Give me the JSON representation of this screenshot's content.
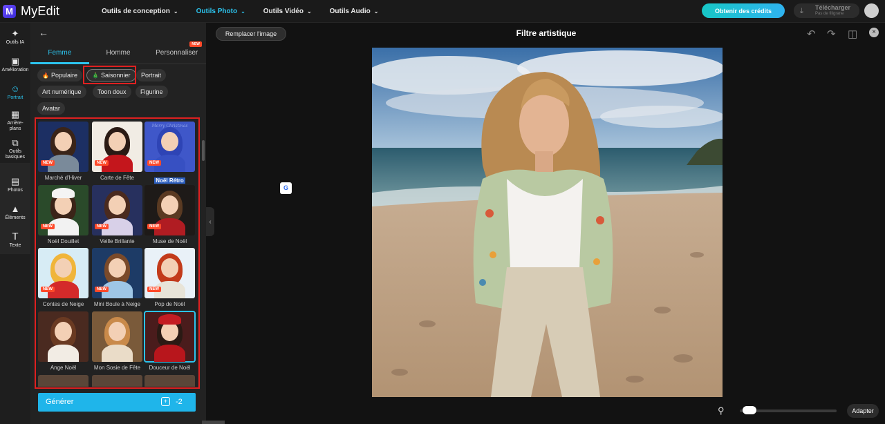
{
  "app": {
    "name": "MyEdit",
    "logo_letter": "M"
  },
  "nav": [
    {
      "label": "Outils de conception",
      "active": false
    },
    {
      "label": "Outils Photo",
      "active": true
    },
    {
      "label": "Outils Vidéo",
      "active": false
    },
    {
      "label": "Outils Audio",
      "active": false
    }
  ],
  "header": {
    "credits_label": "Obtenir des crédits",
    "download_label": "Télécharger",
    "download_sublabel": "Pas de filigrane"
  },
  "rail": [
    {
      "label": "Outils IA",
      "icon": "magic-wand-icon",
      "active": false
    },
    {
      "label": "Amélioration",
      "icon": "image-enhance-icon",
      "active": false
    },
    {
      "label": "Portrait",
      "icon": "portrait-icon",
      "active": true
    },
    {
      "label": "Arrière-plans",
      "icon": "background-icon",
      "active": false
    },
    {
      "label": "Outils basiques",
      "icon": "crop-icon",
      "active": false
    },
    {
      "label": "Photos",
      "icon": "photo-icon",
      "active": false
    },
    {
      "label": "Éléments",
      "icon": "elements-icon",
      "active": false
    },
    {
      "label": "Texte",
      "icon": "text-icon",
      "active": false
    }
  ],
  "panel": {
    "tabs": [
      {
        "label": "Femme",
        "active": true
      },
      {
        "label": "Homme",
        "active": false
      },
      {
        "label": "Personnaliser",
        "active": false,
        "badge": "NEW"
      }
    ],
    "chips": [
      {
        "label": "Populaire",
        "emoji": "🔥",
        "selected": false
      },
      {
        "label": "Saisonnier",
        "emoji": "🎄",
        "selected": true
      },
      {
        "label": "Portrait",
        "emoji": "",
        "selected": false
      },
      {
        "label": "Art numérique",
        "emoji": "",
        "selected": false
      },
      {
        "label": "Toon doux",
        "emoji": "",
        "selected": false
      },
      {
        "label": "Figurine",
        "emoji": "",
        "selected": false
      },
      {
        "label": "Avatar",
        "emoji": "",
        "selected": false
      }
    ],
    "styles": [
      {
        "label": "Marché d'Hiver",
        "new": true,
        "bg": "#1c2f63",
        "hair": "#3a2418",
        "body": "#7a8a9a",
        "hat": ""
      },
      {
        "label": "Carte de Fête",
        "new": true,
        "bg": "#f1ece4",
        "hair": "#2a1a14",
        "body": "#c4161c",
        "hat": ""
      },
      {
        "label": "Noël Rétro",
        "new": true,
        "bg": "#3f57c9",
        "hair": "#2e44b5",
        "body": "#3750c2",
        "hat": "",
        "highlight": true,
        "thumb_text": "Merry Christmas"
      },
      {
        "label": "Noël Douillet",
        "new": true,
        "bg": "#2a4a2a",
        "hair": "#3b2418",
        "body": "#f2f2f2",
        "hat": "#f4f4f4"
      },
      {
        "label": "Veille Brillante",
        "new": true,
        "bg": "#27305e",
        "hair": "#4a2a1e",
        "body": "#d8d0e8",
        "hat": ""
      },
      {
        "label": "Muse de Noël",
        "new": true,
        "bg": "#1e1a18",
        "hair": "#5a3a22",
        "body": "#b01c22",
        "hat": ""
      },
      {
        "label": "Contes de Neige",
        "new": true,
        "bg": "#d7ecf5",
        "hair": "#f0b53a",
        "body": "#d42a2a",
        "hat": ""
      },
      {
        "label": "Mini Boule à Neige",
        "new": true,
        "bg": "#1d3b66",
        "hair": "#7a4a2a",
        "body": "#9ec6e6",
        "hat": ""
      },
      {
        "label": "Pop de Noël",
        "new": true,
        "bg": "#e9f1f8",
        "hair": "#c23a1a",
        "body": "#e8e4d8",
        "hat": ""
      },
      {
        "label": "Ange Noël",
        "new": false,
        "bg": "#4a2a20",
        "hair": "#6a3a22",
        "body": "#f2ece4",
        "hat": ""
      },
      {
        "label": "Mon Sosie de Fête",
        "new": false,
        "bg": "#7a5a3a",
        "hair": "#c98a4a",
        "body": "#eadcc8",
        "hat": ""
      },
      {
        "label": "Douceur de Noël",
        "new": false,
        "bg": "#4a1c1c",
        "hair": "#2a1a14",
        "body": "#b8161c",
        "hat": "#c41c22",
        "selected": true
      }
    ],
    "generate_label": "Générer",
    "generate_cost": "-2"
  },
  "canvas": {
    "replace_label": "Remplacer l'image",
    "title": "Filtre artistique",
    "translate_glyph": "G",
    "fit_label": "Adapter",
    "zoom_level": 0.05
  }
}
